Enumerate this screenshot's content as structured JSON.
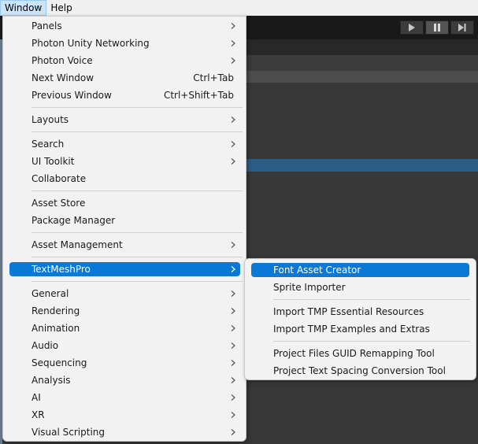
{
  "menubar": {
    "items": [
      {
        "label": "Window",
        "active": true
      },
      {
        "label": "Help",
        "active": false
      }
    ]
  },
  "play_controls": {
    "icons": [
      "play-icon",
      "pause-icon",
      "step-icon"
    ]
  },
  "window_menu": {
    "items": [
      {
        "label": "Panels",
        "shortcut": "",
        "submenu": true
      },
      {
        "label": "Photon Unity Networking",
        "shortcut": "",
        "submenu": true
      },
      {
        "label": "Photon Voice",
        "shortcut": "",
        "submenu": true
      },
      {
        "label": "Next Window",
        "shortcut": "Ctrl+Tab",
        "submenu": false
      },
      {
        "label": "Previous Window",
        "shortcut": "Ctrl+Shift+Tab",
        "submenu": false
      },
      {
        "label": "Layouts",
        "shortcut": "",
        "submenu": true
      },
      {
        "label": "Search",
        "shortcut": "",
        "submenu": true
      },
      {
        "label": "UI Toolkit",
        "shortcut": "",
        "submenu": true
      },
      {
        "label": "Collaborate",
        "shortcut": "",
        "submenu": false
      },
      {
        "label": "Asset Store",
        "shortcut": "",
        "submenu": false
      },
      {
        "label": "Package Manager",
        "shortcut": "",
        "submenu": false
      },
      {
        "label": "Asset Management",
        "shortcut": "",
        "submenu": true
      },
      {
        "label": "TextMeshPro",
        "shortcut": "",
        "submenu": true,
        "highlighted": true
      },
      {
        "label": "General",
        "shortcut": "",
        "submenu": true
      },
      {
        "label": "Rendering",
        "shortcut": "",
        "submenu": true
      },
      {
        "label": "Animation",
        "shortcut": "",
        "submenu": true
      },
      {
        "label": "Audio",
        "shortcut": "",
        "submenu": true
      },
      {
        "label": "Sequencing",
        "shortcut": "",
        "submenu": true
      },
      {
        "label": "Analysis",
        "shortcut": "",
        "submenu": true
      },
      {
        "label": "AI",
        "shortcut": "",
        "submenu": true
      },
      {
        "label": "XR",
        "shortcut": "",
        "submenu": true
      },
      {
        "label": "Visual Scripting",
        "shortcut": "",
        "submenu": true
      }
    ]
  },
  "textmeshpro_submenu": {
    "items": [
      {
        "label": "Font Asset Creator",
        "highlighted": true
      },
      {
        "label": "Sprite Importer"
      },
      {
        "label": "Import TMP Essential Resources"
      },
      {
        "label": "Import TMP Examples and Extras"
      },
      {
        "label": "Project Files GUID Remapping Tool"
      },
      {
        "label": "Project Text Spacing Conversion Tool"
      }
    ]
  },
  "colors": {
    "highlight": "#0a78d7",
    "menu_background": "#f2f2f2",
    "editor_background": "#383838"
  }
}
